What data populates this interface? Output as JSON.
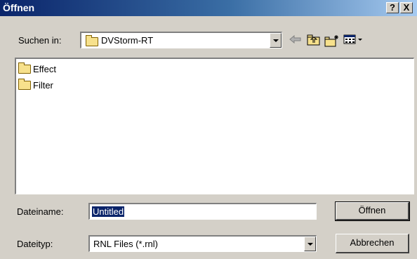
{
  "window": {
    "title": "Öffnen",
    "help_button": "?",
    "close_button": "X"
  },
  "look_in": {
    "label": "Suchen in:",
    "value": "DVStorm-RT"
  },
  "toolbar": {
    "back_icon": "back-arrow-icon",
    "up_icon": "up-folder-icon",
    "new_folder_icon": "new-folder-icon",
    "view_menu_icon": "view-menu-icon"
  },
  "file_list": {
    "items": [
      "Effect",
      "Filter"
    ]
  },
  "filename": {
    "label": "Dateiname:",
    "value": "Untitled"
  },
  "filetype": {
    "label": "Dateityp:",
    "value": "RNL Files (*.rnl)"
  },
  "buttons": {
    "open": "Öffnen",
    "cancel": "Abbrechen"
  },
  "colors": {
    "title_start": "#0a246a",
    "title_end": "#a6caf0",
    "face": "#d4d0c8",
    "selection": "#0a246a"
  }
}
